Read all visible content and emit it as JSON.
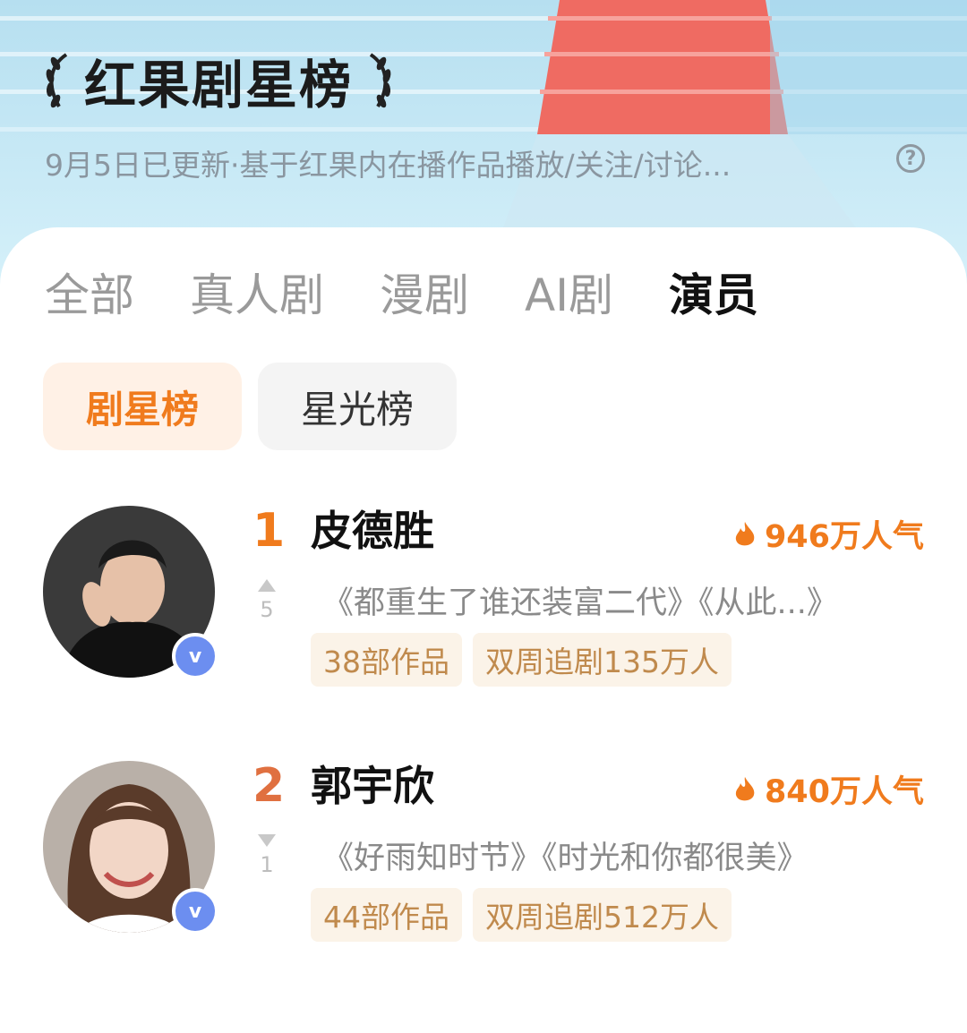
{
  "header": {
    "title": "红果剧星榜",
    "subtitle": "9月5日已更新·基于红果内在播作品播放/关注/讨论...",
    "help_icon": "question-circle-icon"
  },
  "tabs": [
    {
      "label": "全部",
      "active": false
    },
    {
      "label": "真人剧",
      "active": false
    },
    {
      "label": "漫剧",
      "active": false
    },
    {
      "label": "AI剧",
      "active": false
    },
    {
      "label": "演员",
      "active": true
    }
  ],
  "subtabs": [
    {
      "label": "剧星榜",
      "active": true
    },
    {
      "label": "星光榜",
      "active": false
    }
  ],
  "colors": {
    "accent": "#f07b1d",
    "tag_bg": "#fbf3e8",
    "tag_text": "#c08a4d"
  },
  "ranking": [
    {
      "rank": "1",
      "name": "皮德胜",
      "popularity": "946万人气",
      "trend": "up",
      "trend_value": "5",
      "works": "《都重生了谁还装富二代》《从此...》",
      "tags": [
        "38部作品",
        "双周追剧135万人"
      ]
    },
    {
      "rank": "2",
      "name": "郭宇欣",
      "popularity": "840万人气",
      "trend": "down",
      "trend_value": "1",
      "works": "《好雨知时节》《时光和你都很美》",
      "tags": [
        "44部作品",
        "双周追剧512万人"
      ]
    }
  ]
}
